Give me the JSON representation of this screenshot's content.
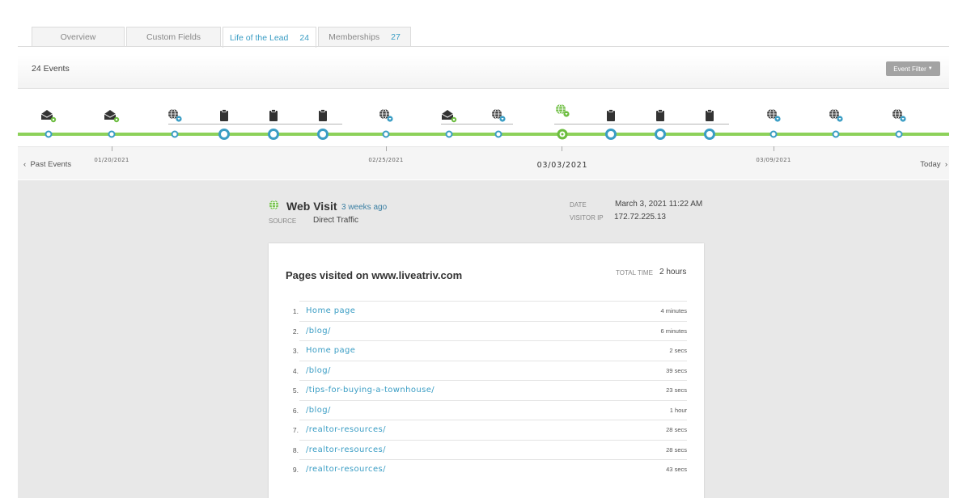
{
  "tabs": [
    {
      "label": "Overview",
      "count": ""
    },
    {
      "label": "Custom Fields",
      "count": ""
    },
    {
      "label": "Life of the Lead",
      "count": "24"
    },
    {
      "label": "Memberships",
      "count": "27"
    }
  ],
  "events": {
    "count_label": "24 Events",
    "filter_label": "Event Filter"
  },
  "timeline": {
    "past_label": "Past Events",
    "today_label": "Today",
    "dates": [
      "01/20/2021",
      "02/25/2021",
      "03/03/2021",
      "03/09/2021"
    ],
    "icons": [
      "email-gear-icon",
      "email-gear-icon",
      "globe-icon",
      "clipboard-icon",
      "clipboard-icon",
      "clipboard-icon",
      "globe-icon",
      "email-gear-icon",
      "globe-icon",
      "globe-icon",
      "clipboard-icon",
      "clipboard-icon",
      "clipboard-icon",
      "globe-icon",
      "globe-icon",
      "globe-icon"
    ]
  },
  "visit": {
    "title": "Web Visit",
    "ago": "3 weeks ago",
    "source_label": "SOURCE",
    "source": "Direct Traffic",
    "date_label": "DATE",
    "date": "March 3, 2021 11:22 AM",
    "ip_label": "VISITOR IP",
    "ip": "172.72.225.13"
  },
  "pages": {
    "title": "Pages visited on www.liveatriv.com",
    "total_label": "TOTAL TIME",
    "total": "2 hours",
    "rows": [
      {
        "num": "1.",
        "page": "Home page",
        "dur": "4 minutes"
      },
      {
        "num": "2.",
        "page": "/blog/",
        "dur": "6 minutes"
      },
      {
        "num": "3.",
        "page": "Home page",
        "dur": "2 secs"
      },
      {
        "num": "4.",
        "page": "/blog/",
        "dur": "39 secs"
      },
      {
        "num": "5.",
        "page": "/tips-for-buying-a-townhouse/",
        "dur": "23 secs"
      },
      {
        "num": "6.",
        "page": "/blog/",
        "dur": "1 hour"
      },
      {
        "num": "7.",
        "page": "/realtor-resources/",
        "dur": "28 secs"
      },
      {
        "num": "8.",
        "page": "/realtor-resources/",
        "dur": "28 secs"
      },
      {
        "num": "9.",
        "page": "/realtor-resources/",
        "dur": "43 secs"
      }
    ]
  },
  "colors": {
    "accent": "#3a9dc4",
    "green": "#8dd15a",
    "active_green": "#6cbd3f"
  }
}
